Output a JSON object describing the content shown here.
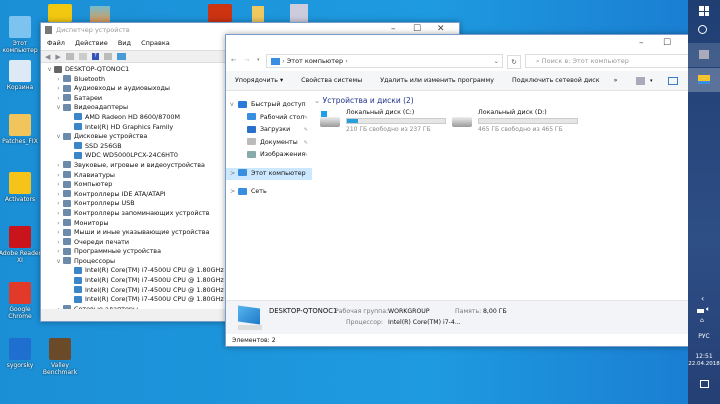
{
  "desktop": {
    "icons": [
      {
        "label": "Этот компьютер",
        "icon": "computer-icon"
      },
      {
        "label": "Корзина",
        "icon": "recycle-bin-icon"
      },
      {
        "label": "Patches_FIX",
        "icon": "folder-icon"
      },
      {
        "label": "Activators",
        "icon": "key-icon"
      },
      {
        "label": "Adobe Reader XI",
        "icon": "pdf-icon"
      },
      {
        "label": "Google Chrome",
        "icon": "chrome-icon"
      },
      {
        "label": "sygorsky",
        "icon": "app-icon"
      },
      {
        "label": "Valley Benchmark",
        "icon": "benchmark-icon"
      }
    ]
  },
  "devmgr": {
    "title": "Диспетчер устройств",
    "menu": [
      "Файл",
      "Действие",
      "Вид",
      "Справка"
    ],
    "root": "DESKTOP-QTONOC1",
    "tree": [
      {
        "label": "Bluetooth",
        "level": 1,
        "expanded": false
      },
      {
        "label": "Аудиовходы и аудиовыходы",
        "level": 1,
        "expanded": false
      },
      {
        "label": "Батареи",
        "level": 1,
        "expanded": false
      },
      {
        "label": "Видеоадаптеры",
        "level": 1,
        "expanded": true
      },
      {
        "label": "AMD Radeon HD 8600/8700M",
        "level": 2
      },
      {
        "label": "Intel(R) HD Graphics Family",
        "level": 2
      },
      {
        "label": "Дисковые устройства",
        "level": 1,
        "expanded": true
      },
      {
        "label": "SSD 256GB",
        "level": 2
      },
      {
        "label": "WDC WD5000LPCX-24C6HT0",
        "level": 2
      },
      {
        "label": "Звуковые, игровые и видеоустройства",
        "level": 1,
        "expanded": false
      },
      {
        "label": "Клавиатуры",
        "level": 1,
        "expanded": false
      },
      {
        "label": "Компьютер",
        "level": 1,
        "expanded": false
      },
      {
        "label": "Контроллеры IDE ATA/ATAPI",
        "level": 1,
        "expanded": false
      },
      {
        "label": "Контроллеры USB",
        "level": 1,
        "expanded": false
      },
      {
        "label": "Контроллеры запоминающих устройств",
        "level": 1,
        "expanded": false
      },
      {
        "label": "Мониторы",
        "level": 1,
        "expanded": false
      },
      {
        "label": "Мыши и иные указывающие устройства",
        "level": 1,
        "expanded": false
      },
      {
        "label": "Очереди печати",
        "level": 1,
        "expanded": false
      },
      {
        "label": "Программные устройства",
        "level": 1,
        "expanded": false
      },
      {
        "label": "Процессоры",
        "level": 1,
        "expanded": true
      },
      {
        "label": "Intel(R) Core(TM) i7-4500U CPU @ 1.80GHz",
        "level": 2
      },
      {
        "label": "Intel(R) Core(TM) i7-4500U CPU @ 1.80GHz",
        "level": 2
      },
      {
        "label": "Intel(R) Core(TM) i7-4500U CPU @ 1.80GHz",
        "level": 2
      },
      {
        "label": "Intel(R) Core(TM) i7-4500U CPU @ 1.80GHz",
        "level": 2
      },
      {
        "label": "Сетевые адаптеры",
        "level": 1,
        "expanded": false
      }
    ]
  },
  "explorer": {
    "address": "Этот компьютер",
    "search_placeholder": "Поиск в: Этот компьютер",
    "toolbar": [
      "Упорядочить ▾",
      "Свойства системы",
      "Удалить или изменить программу",
      "Подключить сетевой диск",
      "»"
    ],
    "nav": [
      {
        "label": "Быстрый доступ",
        "icon": "star-icon",
        "color": "#2a7ad8",
        "indent": 0,
        "pin": false,
        "chev": "v"
      },
      {
        "label": "Рабочий стол",
        "icon": "desktop-icon",
        "color": "#3a8ee0",
        "indent": 1,
        "pin": true
      },
      {
        "label": "Загрузки",
        "icon": "download-icon",
        "color": "#2a6fc9",
        "indent": 1,
        "pin": true
      },
      {
        "label": "Документы",
        "icon": "document-icon",
        "color": "#bbb",
        "indent": 1,
        "pin": true
      },
      {
        "label": "Изображения",
        "icon": "image-icon",
        "color": "#8aa",
        "indent": 1,
        "pin": true
      },
      {
        "label": "Этот компьютер",
        "icon": "computer-icon",
        "color": "#3a8ee0",
        "indent": 0,
        "pin": false,
        "chev": ">",
        "selected": true
      },
      {
        "label": "Сеть",
        "icon": "network-icon",
        "color": "#3a8ee0",
        "indent": 0,
        "pin": false,
        "chev": ">"
      }
    ],
    "section": "Устройства и диски (2)",
    "drives": [
      {
        "name": "Локальный диск (C:)",
        "free": "210 ГБ свободно из 237 ГБ",
        "used_fraction": 0.114,
        "system": true
      },
      {
        "name": "Локальный диск (D:)",
        "free": "465 ГБ свободно из 465 ГБ",
        "used_fraction": 0.0,
        "system": false
      }
    ],
    "details": {
      "computer": "DESKTOP-QTONOC1",
      "workgroup_label": "Рабочая группа:",
      "workgroup": "WORKGROUP",
      "memory_label": "Память:",
      "memory": "8,00 ГБ",
      "cpu_label": "Процессор:",
      "cpu": "Intel(R) Core(TM) i7-4..."
    },
    "status": "Элементов: 2"
  },
  "taskbar": {
    "lang": "РУС",
    "time": "12:51",
    "date": "22.04.2018"
  },
  "colors": {
    "accent": "#26a0da",
    "taskbar": "#243f74",
    "selected": "#cce8ff"
  }
}
